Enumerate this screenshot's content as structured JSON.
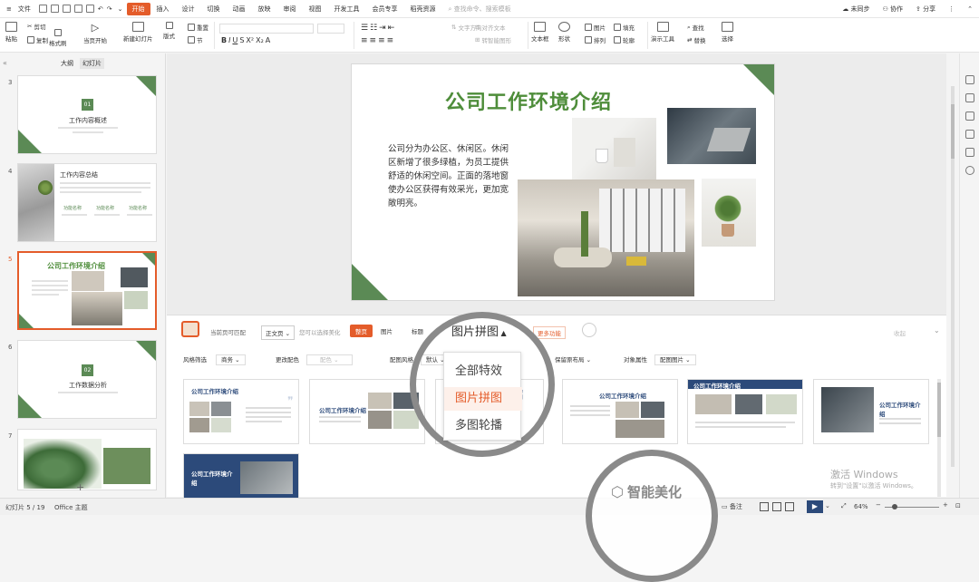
{
  "menubar": {
    "file": "文件",
    "tabs": [
      "开始",
      "插入",
      "设计",
      "切换",
      "动画",
      "放映",
      "审阅",
      "视图",
      "开发工具",
      "会员专享",
      "稻壳资源"
    ],
    "active_tab": "开始",
    "search_placeholder": "查找命令、搜索模板",
    "unsynced": "未同步",
    "collab": "协作",
    "share": "分享"
  },
  "ribbon": {
    "paste": "粘贴",
    "cut": "剪切",
    "copy": "复制",
    "format_painter": "格式刷",
    "play_from_current": "当页开始",
    "new_slide": "新建幻灯片",
    "layout": "版式",
    "section": "节",
    "reset": "重置",
    "text_direction": "文字方向",
    "align_text": "对齐文本",
    "smart_art": "转智能图形",
    "textbox": "文本框",
    "shape": "形状",
    "picture": "图片",
    "arrange": "排列",
    "fill": "填充",
    "outline": "轮廓",
    "presentation_tools": "演示工具",
    "find": "查找",
    "replace": "替换",
    "select": "选择"
  },
  "leftpanel": {
    "tab_outline": "大纲",
    "tab_slides": "幻灯片",
    "thumbs": [
      {
        "num": "3",
        "badge": "01",
        "title": "工作内容概述"
      },
      {
        "num": "4",
        "title": "工作内容总结",
        "items": [
          "功能名称",
          "功能名称",
          "功能名称"
        ]
      },
      {
        "num": "5",
        "title": "公司工作环境介绍"
      },
      {
        "num": "6",
        "badge": "02",
        "title": "工作数据分析"
      },
      {
        "num": "7"
      }
    ]
  },
  "slide": {
    "title": "公司工作环境介绍",
    "body": "公司分为办公区、休闲区。休闲区新增了很多绿植，为员工提供舒适的休闲空间。正面的落地窗使办公区获得有效采光，更加宽敞明亮。"
  },
  "beautify": {
    "current_page_label": "当前页可匹配",
    "text_page": "正文页",
    "hint": "您可以选择美化",
    "chips": [
      "整页",
      "图片",
      "标题"
    ],
    "layout_type": "图片拼图",
    "more_label": "更多功能",
    "collapse": "收起",
    "filters": [
      {
        "label": "风格筛选",
        "value": "商务"
      },
      {
        "label": "更改配色",
        "value": "配色"
      },
      {
        "label": "配图风格",
        "value": "默认"
      },
      {
        "label": "保留原布局",
        "value": ""
      },
      {
        "label": "对象属性",
        "value": "配图图片"
      }
    ],
    "card_title": "公司工作环境介绍",
    "dropdown": [
      "全部特效",
      "图片拼图",
      "多图轮播"
    ],
    "dropdown_selected": "图片拼图",
    "smart_beautify": "智能美化"
  },
  "watermark": {
    "line1": "激活 Windows",
    "line2": "转到\"设置\"以激活 Windows。"
  },
  "statusbar": {
    "slide_indicator": "幻灯片 5 / 19",
    "theme": "Office 主题",
    "notes": "备注",
    "zoom": "64%"
  },
  "colors": {
    "accent": "#e45c2a",
    "slide_green": "#5b8a55",
    "title_green": "#4e8d3a",
    "navy": "#2c4a7a"
  }
}
